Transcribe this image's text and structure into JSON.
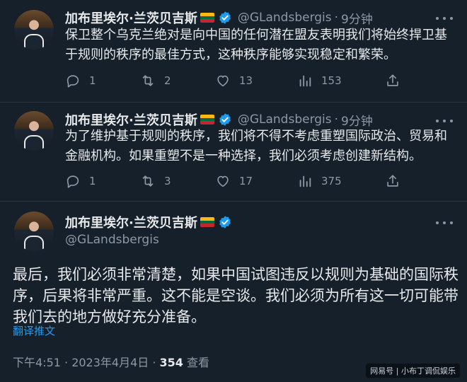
{
  "colors": {
    "background": "#15202b",
    "accent": "#1d9bf0",
    "muted": "#8b98a5",
    "text": "#e7e9ea"
  },
  "flag": [
    "#fdb913",
    "#006a44",
    "#c1272d"
  ],
  "tweets": [
    {
      "name": "加布里埃尔·兰茨贝吉斯",
      "handle": "@GLandsbergis",
      "dot": "·",
      "time": "9分钟",
      "text": "保卫整个乌克兰绝对是向中国的任何潜在盟友表明我们将始终捍卫基于规则的秩序的最佳方式，这种秩序能够实现稳定和繁荣。",
      "replies": "1",
      "retweets": "2",
      "likes": "13",
      "views": "153"
    },
    {
      "name": "加布里埃尔·兰茨贝吉斯",
      "handle": "@GLandsbergis",
      "dot": "·",
      "time": "9分钟",
      "text": "为了维护基于规则的秩序，我们将不得不考虑重塑国际政治、贸易和金融机构。如果重塑不是一种选择，我们必须考虑创建新结构。",
      "replies": "1",
      "retweets": "3",
      "likes": "17",
      "views": "375"
    }
  ],
  "main_tweet": {
    "name": "加布里埃尔·兰茨贝吉斯",
    "handle": "@GLandsbergis",
    "text": "最后，我们必须非常清楚，如果中国试图违反以规则为基础的国际秩序，后果将非常严重。这不能是空谈。我们必须为所有这一切可能带我们去的地方做好充分准备。",
    "translate": "翻译推文",
    "timestamp": "下午4:51 · 2023年4月4日 · ",
    "views": "354",
    "views_label": " 查看"
  },
  "watermark": "网易号 | 小布丁调侃娱乐"
}
